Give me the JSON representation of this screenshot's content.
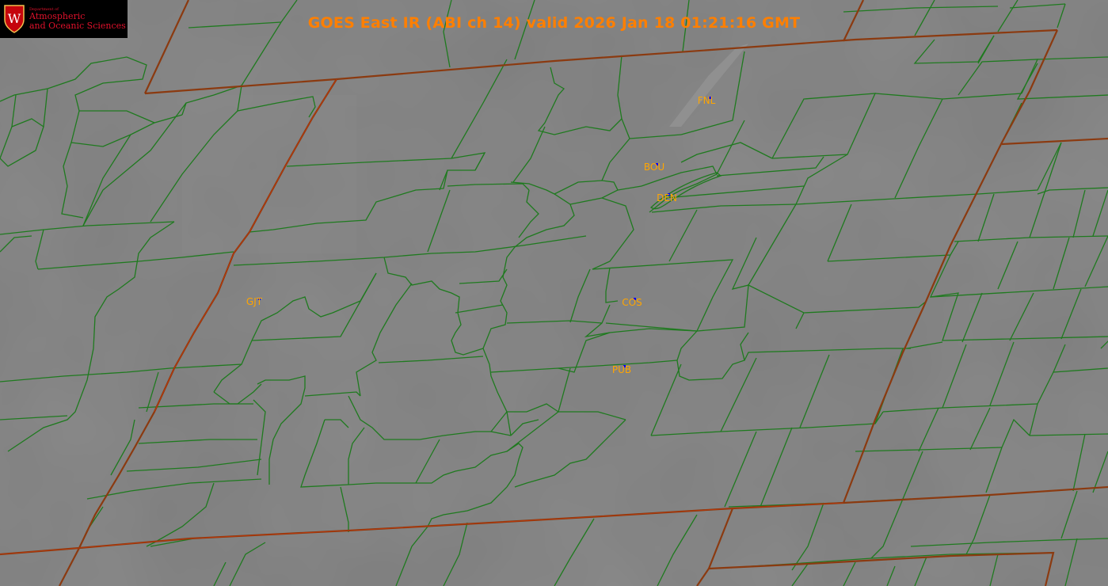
{
  "title": "GOES East IR (ABI ch 14) valid 2026 Jan 18 01:21:16 GMT",
  "logo": {
    "dept": "Department of",
    "line1": "Atmospheric",
    "line2": "and Oceanic Sciences",
    "crest_letter": "W"
  },
  "stations": [
    {
      "id": "FNL",
      "label": "FNL"
    },
    {
      "id": "BOU",
      "label": "BOU"
    },
    {
      "id": "DEN",
      "label": "DEN"
    },
    {
      "id": "GJT",
      "label": "GJT"
    },
    {
      "id": "COS",
      "label": "COS"
    },
    {
      "id": "PUB",
      "label": "PUB"
    }
  ],
  "colors": {
    "background": "#7f7f7f",
    "county_lines": "#1f7a1f",
    "state_lines": "#8b3a10",
    "title": "#ff7f00",
    "station_label": "#ffa500",
    "station_marker": "#0000ff",
    "logo_red": "#e0112b"
  }
}
